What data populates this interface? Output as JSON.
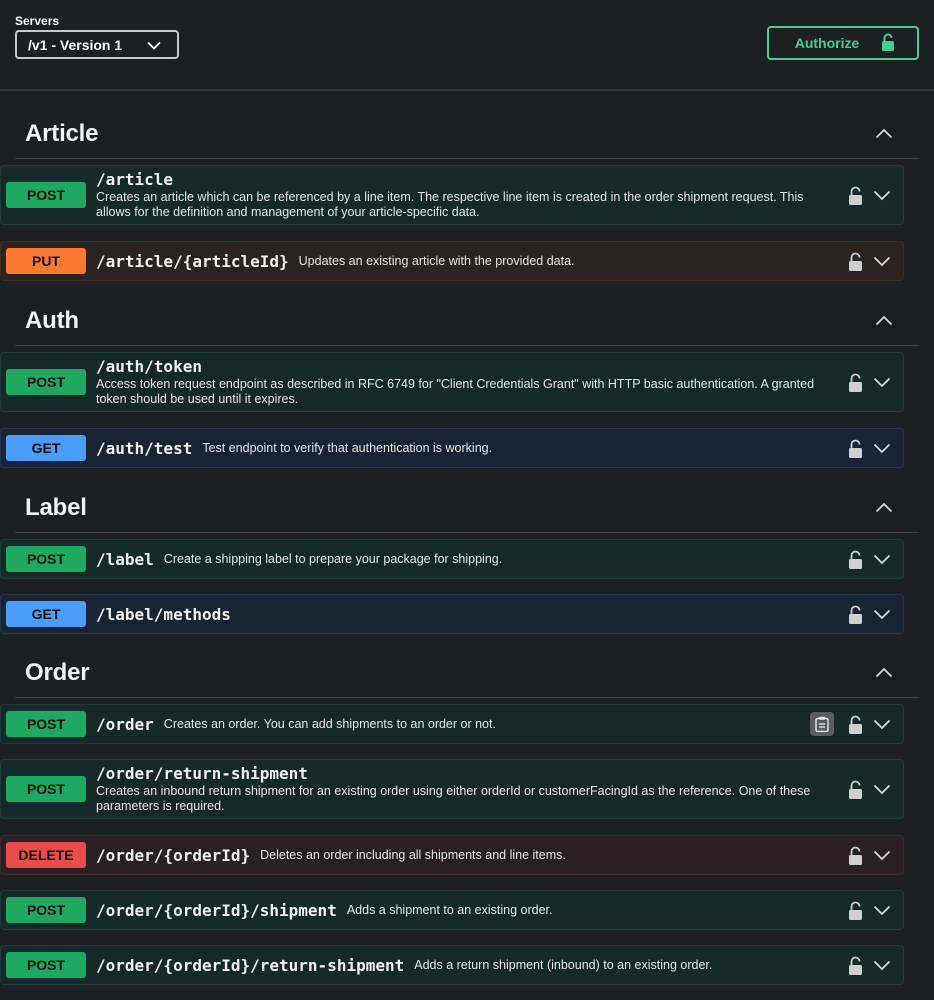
{
  "servers": {
    "label": "Servers",
    "selected": "/v1 - Version 1"
  },
  "authorize": {
    "label": "Authorize"
  },
  "sections": [
    {
      "title": "Article",
      "operations": [
        {
          "method": "POST",
          "path": "/article",
          "summary": "Creates an article which can be referenced by a line item. The respective line item is created in the order shipment request. This allows for the definition and management of your article-specific data."
        },
        {
          "method": "PUT",
          "path": "/article/{articleId}",
          "summary": "Updates an existing article with the provided data."
        }
      ]
    },
    {
      "title": "Auth",
      "operations": [
        {
          "method": "POST",
          "path": "/auth/token",
          "summary": "Access token request endpoint as described in RFC 6749 for \"Client Credentials Grant\" with HTTP basic authentication. A granted token should be used until it expires."
        },
        {
          "method": "GET",
          "path": "/auth/test",
          "summary": "Test endpoint to verify that authentication is working."
        }
      ]
    },
    {
      "title": "Label",
      "operations": [
        {
          "method": "POST",
          "path": "/label",
          "summary": "Create a shipping label to prepare your package for shipping."
        },
        {
          "method": "GET",
          "path": "/label/methods",
          "summary": ""
        }
      ]
    },
    {
      "title": "Order",
      "operations": [
        {
          "method": "POST",
          "path": "/order",
          "summary": "Creates an order. You can add shipments to an order or not."
        },
        {
          "method": "POST",
          "path": "/order/return-shipment",
          "summary": "Creates an inbound return shipment for an existing order using either orderId or customerFacingId as the reference. One of these parameters is required."
        },
        {
          "method": "DELETE",
          "path": "/order/{orderId}",
          "summary": "Deletes an order including all shipments and line items."
        },
        {
          "method": "POST",
          "path": "/order/{orderId}/shipment",
          "summary": "Adds a shipment to an existing order."
        },
        {
          "method": "POST",
          "path": "/order/{orderId}/return-shipment",
          "summary": "Adds a return shipment (inbound) to an existing order."
        }
      ]
    }
  ],
  "icons": {
    "lock": "lock-icon",
    "expand": "chevron-down-icon",
    "collapse": "chevron-up-icon",
    "copy": "clipboard-icon"
  },
  "colors": {
    "post": "#1fa85f",
    "put": "#fc7a2f",
    "get": "#4c9cf9",
    "delete": "#e94d4b",
    "authorize": "#49cc90"
  }
}
